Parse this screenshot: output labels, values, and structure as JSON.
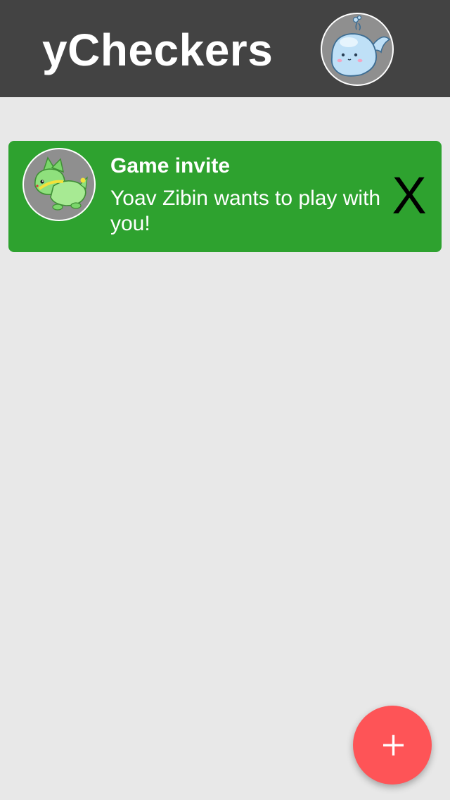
{
  "app": {
    "title": "yCheckers"
  },
  "header": {
    "profile_avatar_icon": "whale-avatar-icon"
  },
  "notifications": [
    {
      "type": "game-invite",
      "title": "Game invite",
      "message": "Yoav Zibin wants to play with you!",
      "avatar_icon": "green-creature-avatar-icon",
      "dismiss_label": "X"
    }
  ],
  "fab": {
    "icon": "plus-icon"
  },
  "colors": {
    "header_bg": "#434343",
    "page_bg": "#e8e8e8",
    "invite_bg": "#2ea22f",
    "fab_bg": "#fe5457"
  }
}
